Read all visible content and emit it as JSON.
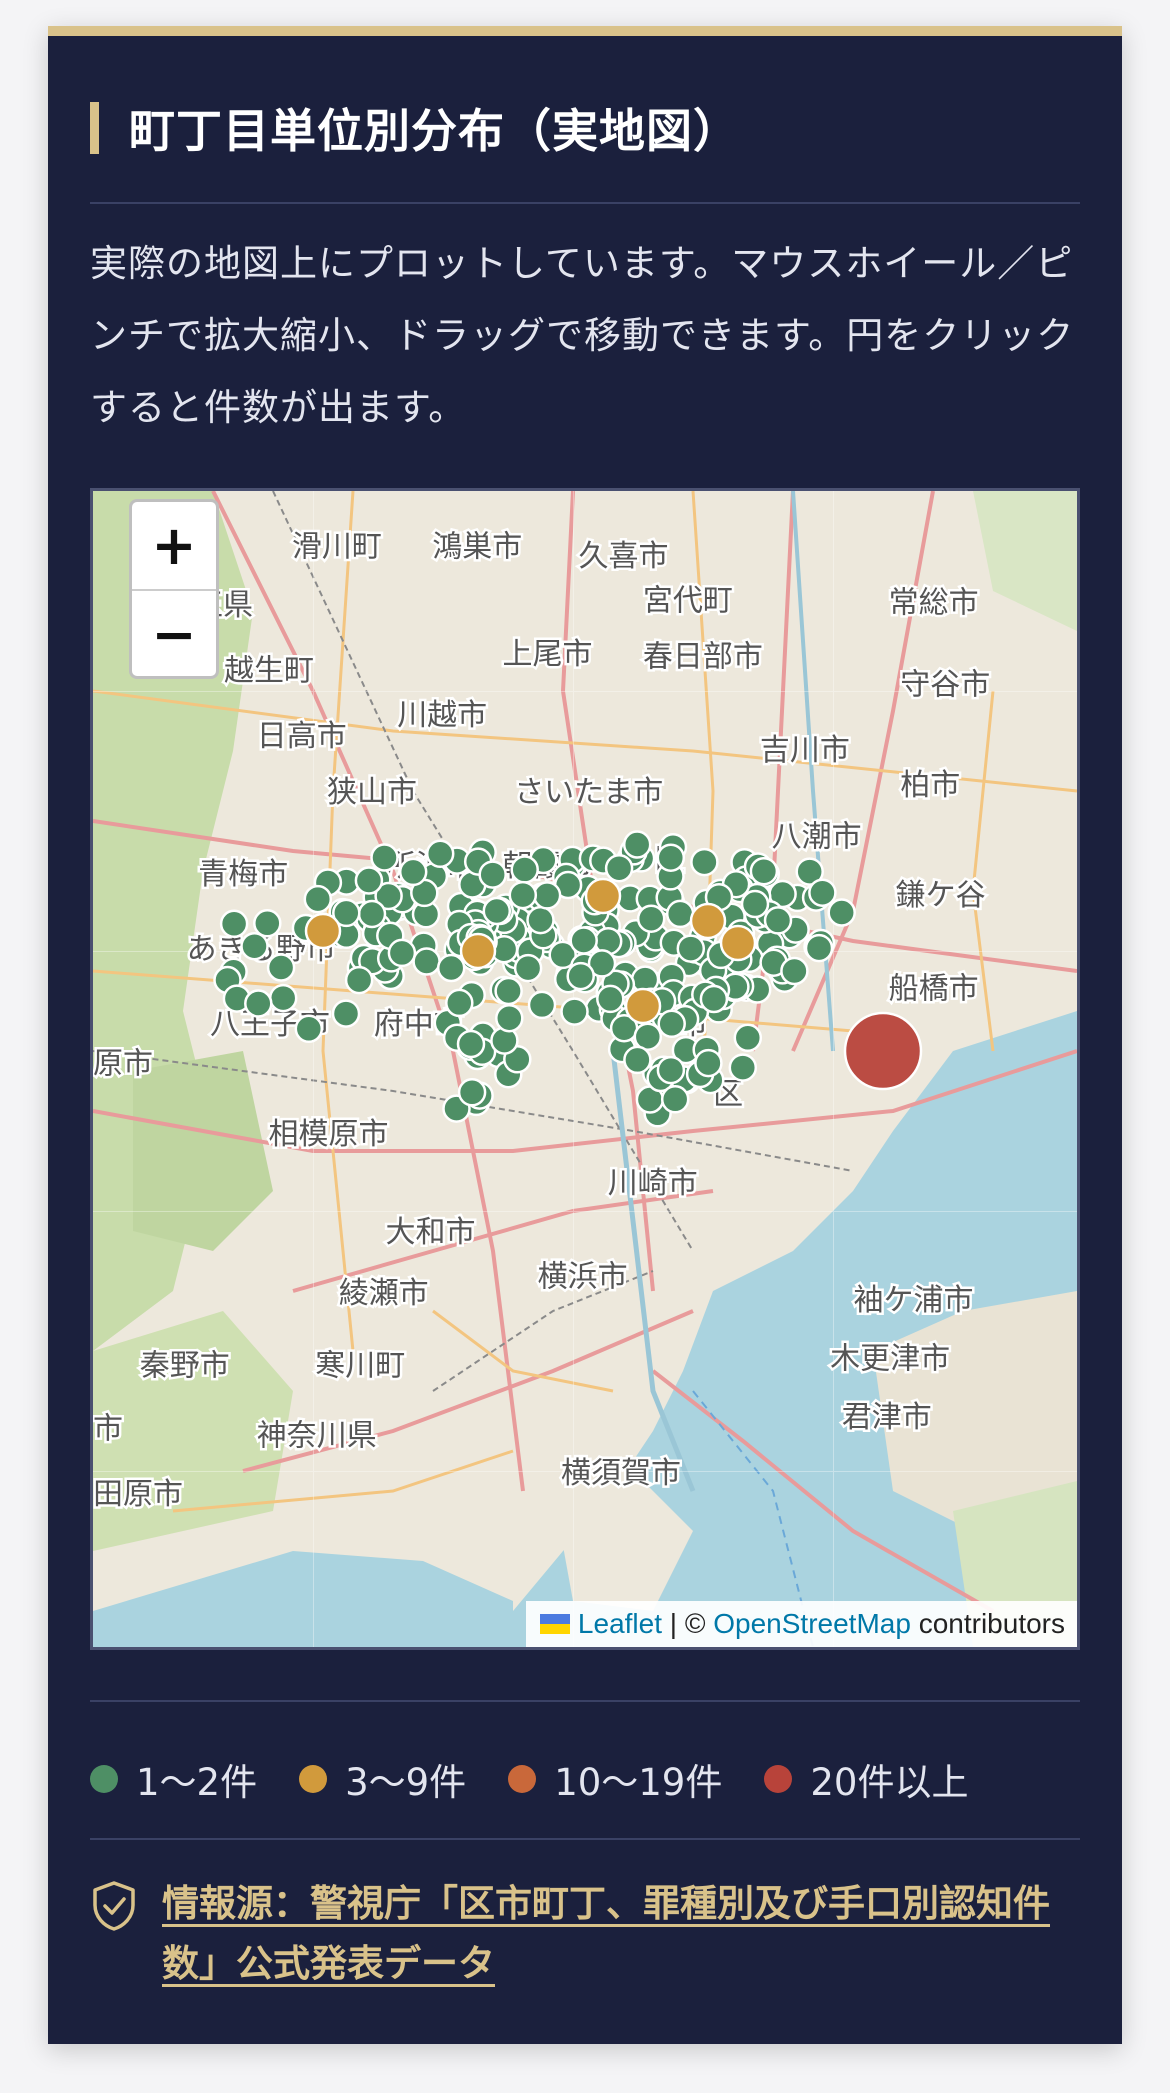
{
  "title": "町丁目単位別分布（実地図）",
  "description": "実際の地図上にプロットしています。マウスホイール／ピンチで拡大縮小、ドラッグで移動できます。円をクリックすると件数が出ます。",
  "map": {
    "zoom_in": "+",
    "zoom_out": "−",
    "attribution": {
      "leaflet": "Leaflet",
      "separator": " | © ",
      "osm": "OpenStreetMap",
      "contributors": " contributors"
    },
    "place_labels": [
      {
        "name": "滑川町",
        "pos": "label-0"
      },
      {
        "name": "鴻巣市",
        "pos": "label-1"
      },
      {
        "name": "久喜市",
        "pos": "label-2"
      },
      {
        "name": "宮代町",
        "pos": "label-3"
      },
      {
        "name": "常総市",
        "pos": "label-4"
      },
      {
        "name": "埼玉県",
        "pos": "label-5"
      },
      {
        "name": "越生町",
        "pos": "label-6"
      },
      {
        "name": "上尾市",
        "pos": "label-7"
      },
      {
        "name": "春日部市",
        "pos": "label-8"
      },
      {
        "name": "守谷市",
        "pos": "label-9"
      },
      {
        "name": "川越市",
        "pos": "label-10"
      },
      {
        "name": "日高市",
        "pos": "label-11"
      },
      {
        "name": "吉川市",
        "pos": "label-12"
      },
      {
        "name": "狭山市",
        "pos": "label-13"
      },
      {
        "name": "さいたま市",
        "pos": "label-14"
      },
      {
        "name": "柏市",
        "pos": "label-15"
      },
      {
        "name": "八潮市",
        "pos": "label-16"
      },
      {
        "name": "所沢市",
        "pos": "label-17"
      },
      {
        "name": "朝霞市",
        "pos": "label-18"
      },
      {
        "name": "青梅市",
        "pos": "label-19"
      },
      {
        "name": "鎌ケ谷",
        "pos": "label-20"
      },
      {
        "name": "あきる野市",
        "pos": "label-21"
      },
      {
        "name": "船橋市",
        "pos": "label-22"
      },
      {
        "name": "八王子市",
        "pos": "label-23"
      },
      {
        "name": "府中市",
        "pos": "label-24"
      },
      {
        "name": "原市",
        "pos": "label-25"
      },
      {
        "name": "相模原市",
        "pos": "label-26"
      },
      {
        "name": "川崎市",
        "pos": "label-27"
      },
      {
        "name": "大和市",
        "pos": "label-28"
      },
      {
        "name": "横浜市",
        "pos": "label-29"
      },
      {
        "name": "綾瀬市",
        "pos": "label-30"
      },
      {
        "name": "袖ケ浦市",
        "pos": "label-31"
      },
      {
        "name": "秦野市",
        "pos": "label-32"
      },
      {
        "name": "寒川町",
        "pos": "label-33"
      },
      {
        "name": "木更津市",
        "pos": "label-34"
      },
      {
        "name": "君津市",
        "pos": "label-35"
      },
      {
        "name": "市",
        "pos": "label-36"
      },
      {
        "name": "神奈川県",
        "pos": "label-37"
      },
      {
        "name": "横須賀市",
        "pos": "label-38"
      },
      {
        "name": "田原市",
        "pos": "label-39"
      },
      {
        "name": "区",
        "pos": "label-40"
      },
      {
        "name": "区",
        "pos": "label-41"
      },
      {
        "name": "市",
        "pos": "label-42"
      }
    ]
  },
  "legend": [
    {
      "label": "1〜2件",
      "color": "#4e8f65"
    },
    {
      "label": "3〜9件",
      "color": "#d19a3c"
    },
    {
      "label": "10〜19件",
      "color": "#c9683a"
    },
    {
      "label": "20件以上",
      "color": "#b8433a"
    }
  ],
  "source": {
    "text": "情報源：警視庁「区市町丁、罪種別及び手口別認知件数」公式発表データ"
  },
  "colors": {
    "card_bg": "#1b203d",
    "accent": "#d9c28a",
    "water": "#aad3df",
    "land": "#ede8dc",
    "forest": "#c8dcaa"
  }
}
